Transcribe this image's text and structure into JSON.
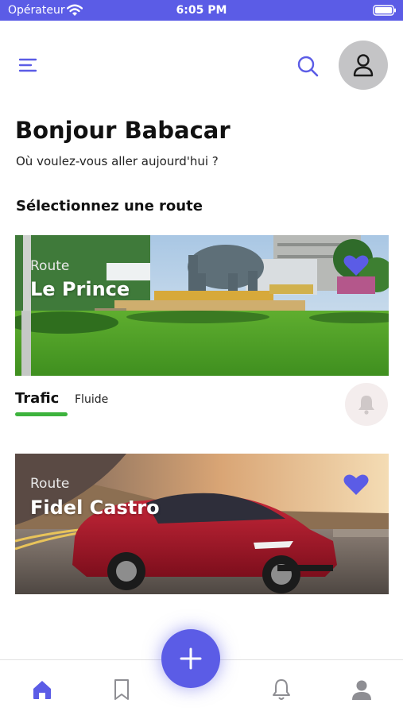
{
  "status_bar": {
    "carrier": "Opérateur",
    "time": "6:05 PM"
  },
  "header": {
    "menu_icon": "hamburger-menu-icon",
    "search_icon": "search-icon",
    "avatar_icon": "user-icon"
  },
  "greeting": {
    "title": "Bonjour Babacar",
    "subtitle": "Où voulez-vous aller aujourd'hui ?"
  },
  "routes_section": {
    "title": "Sélectionnez une route",
    "routes": [
      {
        "label": "Route",
        "name": "Le Prince",
        "favorite": true,
        "traffic_label": "Trafic",
        "traffic_status": "Fluide",
        "traffic_color": "#3db33d",
        "alert_icon": "bell-icon"
      },
      {
        "label": "Route",
        "name": "Fidel Castro",
        "favorite": true
      }
    ]
  },
  "tab_bar": {
    "tabs": [
      {
        "icon": "home-icon",
        "active": true
      },
      {
        "icon": "bookmark-icon",
        "active": false
      },
      {
        "icon": "bell-icon",
        "active": false
      },
      {
        "icon": "user-icon",
        "active": false
      }
    ],
    "fab_icon": "plus-icon"
  },
  "colors": {
    "accent": "#5b5ce6",
    "traffic_fluid": "#3db33d",
    "inactive_icon": "#8e8e93"
  }
}
